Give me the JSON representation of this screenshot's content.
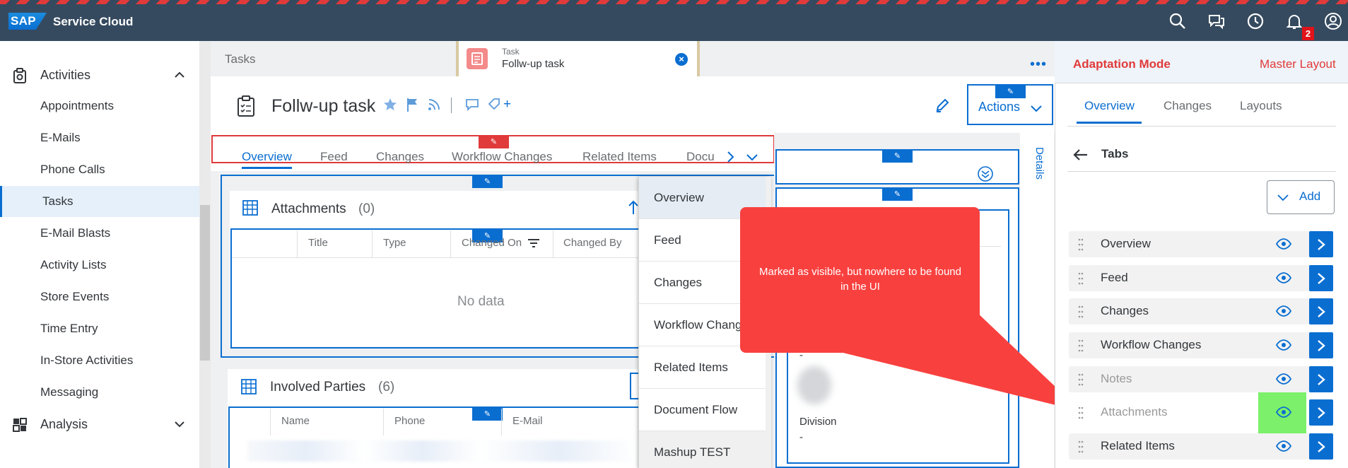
{
  "app": {
    "logo": "SAP",
    "title": "Service Cloud",
    "notifications": "2"
  },
  "icons": [
    "search-icon",
    "chat-icon",
    "clock-icon",
    "bell-icon",
    "user-icon"
  ],
  "sidebar": {
    "groups": [
      {
        "label": "Activities",
        "expanded": true
      },
      {
        "label": "Analysis",
        "expanded": false
      }
    ],
    "items": [
      "Appointments",
      "E-Mails",
      "Phone Calls",
      "Tasks",
      "E-Mail Blasts",
      "Activity Lists",
      "Store Events",
      "Time Entry",
      "In-Store Activities",
      "Messaging"
    ],
    "active": "Tasks"
  },
  "tabs_bar": {
    "tasks_label": "Tasks",
    "open_tab_type": "Task",
    "open_tab_title": "Follw-up task"
  },
  "header": {
    "title": "Follw-up task",
    "plus": "+",
    "actions": "Actions"
  },
  "tabs": [
    "Overview",
    "Feed",
    "Changes",
    "Workflow Changes",
    "Related Items",
    "Docu"
  ],
  "attachments": {
    "title": "Attachments",
    "count": "(0)",
    "columns": [
      "Title",
      "Type",
      "Changed On",
      "Changed By"
    ],
    "empty": "No data"
  },
  "parties": {
    "title": "Involved Parties",
    "count": "(6)",
    "columns": [
      "Name",
      "Phone",
      "E-Mail"
    ]
  },
  "dropdown": [
    "Overview",
    "Feed",
    "Changes",
    "Workflow Changes",
    "Related Items",
    "Document Flow",
    "Mashup TEST"
  ],
  "details": {
    "vertical_tab": "Details",
    "dash1": "-",
    "division_label": "Division",
    "division_value": "-"
  },
  "callout": {
    "text": "Marked as visible, but nowhere to be found in the UI"
  },
  "adaptation": {
    "mode": "Adaptation Mode",
    "layout": "Master Layout",
    "tabs": [
      "Overview",
      "Changes",
      "Layouts"
    ],
    "section": "Tabs",
    "add": "Add",
    "rows": [
      {
        "label": "Overview",
        "dim": false
      },
      {
        "label": "Feed",
        "dim": false
      },
      {
        "label": "Changes",
        "dim": false
      },
      {
        "label": "Workflow Changes",
        "dim": false
      },
      {
        "label": "Notes",
        "dim": true
      },
      {
        "label": "Attachments",
        "dim": true
      },
      {
        "label": "Related Items",
        "dim": false
      }
    ]
  },
  "colors": {
    "shell": "#354a5f",
    "accent": "#0a6ed1",
    "alert": "#e03a3a",
    "callout": "#f8413f",
    "highlight": "#7cf06a"
  }
}
